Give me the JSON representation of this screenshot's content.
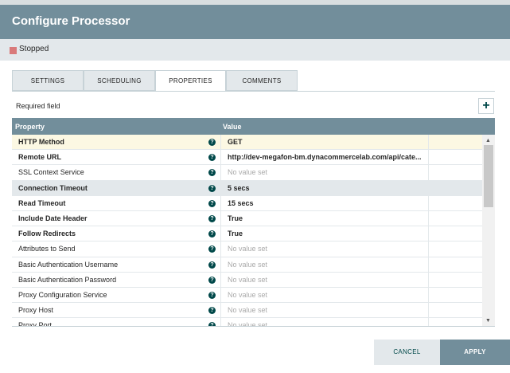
{
  "dialog": {
    "title": "Configure Processor",
    "status": "Stopped",
    "colors": {
      "header": "#728e9b",
      "status_stopped": "#d97a7a",
      "accent": "#004849"
    }
  },
  "tabs": [
    {
      "label": "SETTINGS"
    },
    {
      "label": "SCHEDULING"
    },
    {
      "label": "PROPERTIES",
      "active": true
    },
    {
      "label": "COMMENTS"
    }
  ],
  "required_field_label": "Required field",
  "add_button": "+",
  "table": {
    "headers": {
      "property": "Property",
      "value": "Value"
    },
    "help_icon": "?",
    "rows": [
      {
        "property": "HTTP Method",
        "value": "GET",
        "required": true,
        "set": true
      },
      {
        "property": "Remote URL",
        "value": "http://dev-megafon-bm.dynacommercelab.com/api/cate...",
        "required": true,
        "set": true
      },
      {
        "property": "SSL Context Service",
        "value": "No value set",
        "required": false,
        "set": false
      },
      {
        "property": "Connection Timeout",
        "value": "5 secs",
        "required": true,
        "set": true
      },
      {
        "property": "Read Timeout",
        "value": "15 secs",
        "required": true,
        "set": true
      },
      {
        "property": "Include Date Header",
        "value": "True",
        "required": true,
        "set": true
      },
      {
        "property": "Follow Redirects",
        "value": "True",
        "required": true,
        "set": true
      },
      {
        "property": "Attributes to Send",
        "value": "No value set",
        "required": false,
        "set": false
      },
      {
        "property": "Basic Authentication Username",
        "value": "No value set",
        "required": false,
        "set": false
      },
      {
        "property": "Basic Authentication Password",
        "value": "No value set",
        "required": false,
        "set": false
      },
      {
        "property": "Proxy Configuration Service",
        "value": "No value set",
        "required": false,
        "set": false
      },
      {
        "property": "Proxy Host",
        "value": "No value set",
        "required": false,
        "set": false
      },
      {
        "property": "Proxy Port",
        "value": "No value set",
        "required": false,
        "set": false
      }
    ]
  },
  "footer": {
    "cancel": "CANCEL",
    "apply": "APPLY"
  }
}
